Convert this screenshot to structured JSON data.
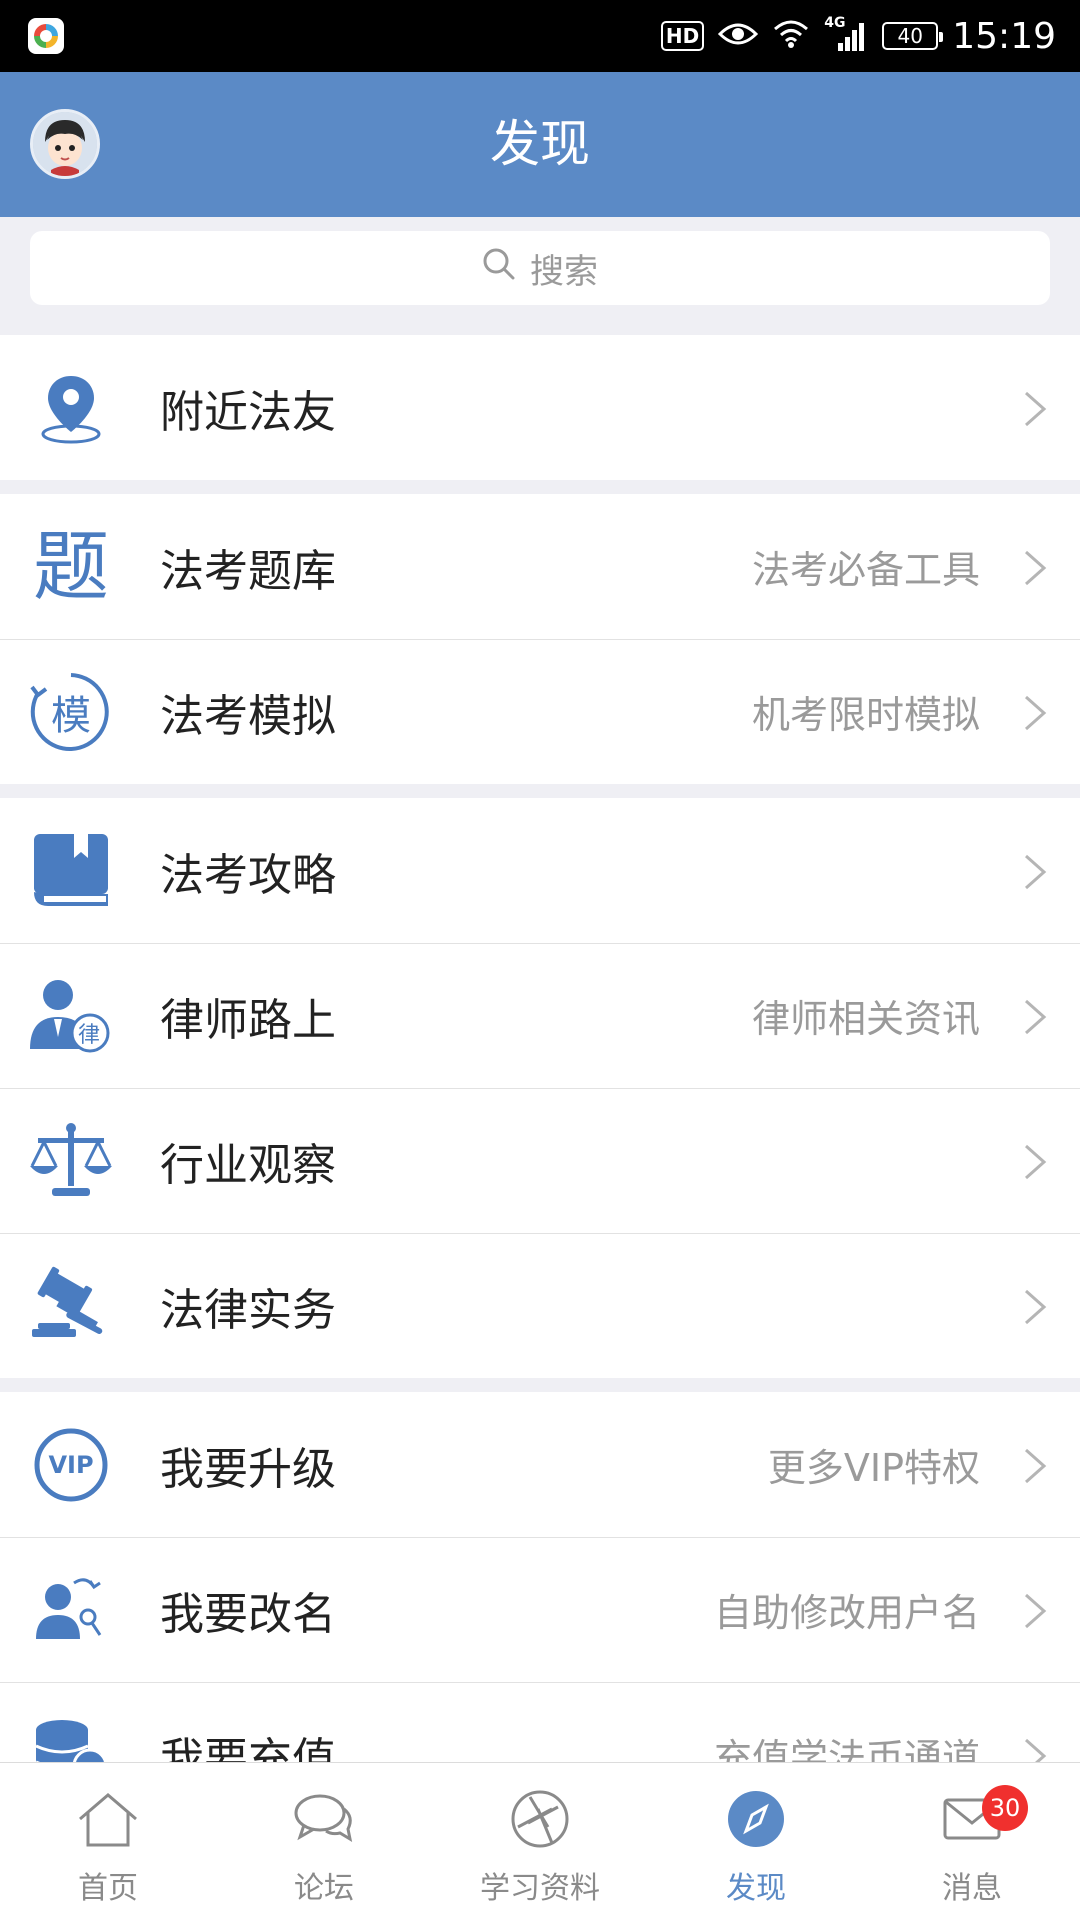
{
  "status_bar": {
    "hd": "HD",
    "network": "4G",
    "battery": "40",
    "time": "15:19"
  },
  "header": {
    "title": "发现"
  },
  "search": {
    "placeholder": "搜索"
  },
  "groups": [
    {
      "rows": [
        {
          "label": "附近法友",
          "sub": "",
          "icon": "location-pin-icon"
        }
      ]
    },
    {
      "rows": [
        {
          "label": "法考题库",
          "sub": "法考必备工具",
          "icon": "question-bank-icon",
          "glyph": "题"
        },
        {
          "label": "法考模拟",
          "sub": "机考限时模拟",
          "icon": "mock-exam-icon",
          "glyph": "模"
        }
      ]
    },
    {
      "rows": [
        {
          "label": "法考攻略",
          "sub": "",
          "icon": "book-icon"
        },
        {
          "label": "律师路上",
          "sub": "律师相关资讯",
          "icon": "lawyer-icon",
          "glyph": "律"
        },
        {
          "label": "行业观察",
          "sub": "",
          "icon": "scales-icon"
        },
        {
          "label": "法律实务",
          "sub": "",
          "icon": "gavel-icon"
        }
      ]
    },
    {
      "rows": [
        {
          "label": "我要升级",
          "sub": "更多VIP特权",
          "icon": "vip-icon",
          "glyph": "VIP"
        },
        {
          "label": "我要改名",
          "sub": "自助修改用户名",
          "icon": "rename-user-icon"
        },
        {
          "label": "我要充值",
          "sub": "充值学法币通道",
          "icon": "coins-icon"
        }
      ]
    }
  ],
  "tabs": [
    {
      "label": "首页",
      "icon": "home-icon",
      "active": false
    },
    {
      "label": "论坛",
      "icon": "chat-bubbles-icon",
      "active": false
    },
    {
      "label": "学习资料",
      "icon": "aperture-icon",
      "active": false
    },
    {
      "label": "发现",
      "icon": "compass-icon",
      "active": true
    },
    {
      "label": "消息",
      "icon": "envelope-icon",
      "active": false,
      "badge": "30"
    }
  ],
  "colors": {
    "accent": "#5b8ac6",
    "badge": "#f0302e",
    "background": "#efeff4"
  }
}
